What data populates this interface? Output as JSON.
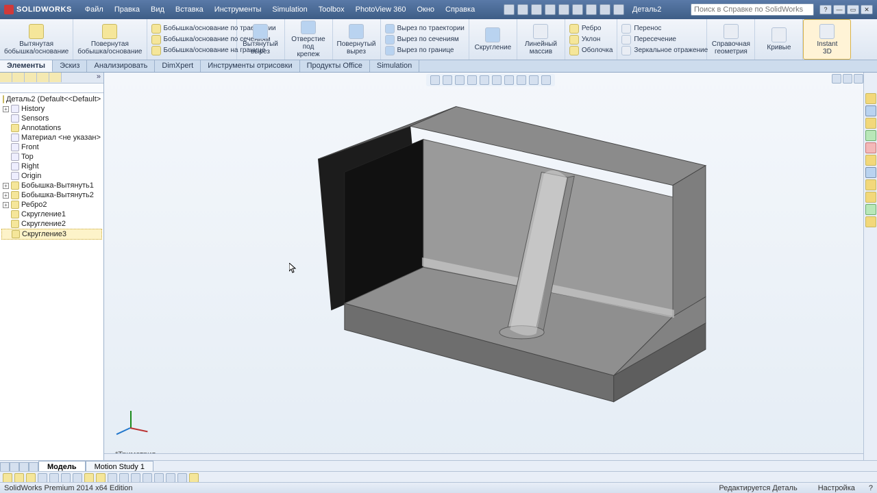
{
  "app": {
    "name": "SOLIDWORKS",
    "docname": "Деталь2"
  },
  "menu": [
    "Файл",
    "Правка",
    "Вид",
    "Вставка",
    "Инструменты",
    "Simulation",
    "Toolbox",
    "PhotoView 360",
    "Окно",
    "Справка"
  ],
  "search_placeholder": "Поиск в Справке по SolidWorks",
  "ribbon": {
    "g1": {
      "l1": "Вытянутая",
      "l2": "бобышка/основание"
    },
    "g2": {
      "l1": "Повернутая",
      "l2": "бобышка/основание"
    },
    "g3": [
      "Бобышка/основание по траектории",
      "Бобышка/основание по сечениям",
      "Бобышка/основание на границе"
    ],
    "g4": {
      "l1": "Вытянутый",
      "l2": "вырез"
    },
    "g5": {
      "l1": "Отверстие",
      "l2": "под",
      "l3": "крепеж"
    },
    "g6": {
      "l1": "Повернутый",
      "l2": "вырез"
    },
    "g7": [
      "Вырез по траектории",
      "Вырез по сечениям",
      "Вырез по границе"
    ],
    "g8": "Скругление",
    "g9": {
      "l1": "Линейный",
      "l2": "массив"
    },
    "g10": [
      "Ребро",
      "Уклон",
      "Оболочка"
    ],
    "g11": [
      "Перенос",
      "Пересечение",
      "Зеркальное отражение"
    ],
    "g12": {
      "l1": "Справочная",
      "l2": "геометрия"
    },
    "g13": "Кривые",
    "g14": {
      "l1": "Instant",
      "l2": "3D"
    }
  },
  "cmdtabs": [
    "Элементы",
    "Эскиз",
    "Анализировать",
    "DimXpert",
    "Инструменты отрисовки",
    "Продукты Office",
    "Simulation"
  ],
  "tree": {
    "root": "Деталь2  (Default<<Default>",
    "items": [
      {
        "t": "History",
        "exp": true
      },
      {
        "t": "Sensors"
      },
      {
        "t": "Annotations",
        "y": true
      },
      {
        "t": "Материал <не указан>"
      },
      {
        "t": "Front"
      },
      {
        "t": "Top"
      },
      {
        "t": "Right"
      },
      {
        "t": "Origin"
      },
      {
        "t": "Бобышка-Вытянуть1",
        "exp": true,
        "y": true
      },
      {
        "t": "Бобышка-Вытянуть2",
        "exp": true,
        "y": true
      },
      {
        "t": "Ребро2",
        "exp": true,
        "y": true
      },
      {
        "t": "Скругление1",
        "y": true
      },
      {
        "t": "Скругление2",
        "y": true
      },
      {
        "t": "Скругление3",
        "y": true,
        "sel": true
      }
    ]
  },
  "triad": "*Триметрия",
  "btabs": [
    "Модель",
    "Motion Study 1"
  ],
  "status": {
    "left": "SolidWorks Premium 2014 x64 Edition",
    "mid": "Редактируется Деталь",
    "right": "Настройка"
  }
}
